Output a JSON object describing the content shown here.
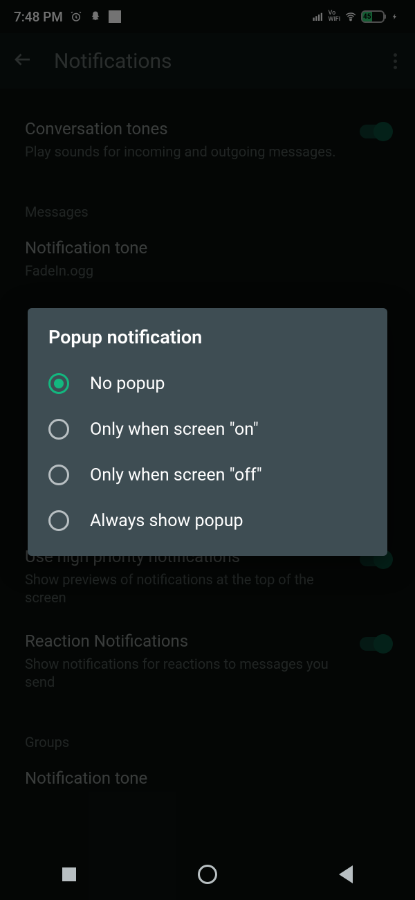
{
  "status": {
    "time": "7:48 PM",
    "battery_pct": "45"
  },
  "appbar": {
    "title": "Notifications"
  },
  "settings": {
    "conv_tones": {
      "title": "Conversation tones",
      "sub": "Play sounds for incoming and outgoing messages."
    },
    "section_messages": "Messages",
    "notif_tone": {
      "title": "Notification tone",
      "sub": "FadeIn.ogg"
    },
    "high_priority": {
      "title": "Use high priority notifications",
      "sub": "Show previews of notifications at the top of the screen"
    },
    "reaction": {
      "title": "Reaction Notifications",
      "sub": "Show notifications for reactions to messages you send"
    },
    "section_groups": "Groups",
    "group_tone": {
      "title": "Notification tone"
    }
  },
  "dialog": {
    "title": "Popup notification",
    "options": {
      "0": "No popup",
      "1": "Only when screen \"on\"",
      "2": "Only when screen \"off\"",
      "3": "Always show popup"
    },
    "selected_index": 0
  }
}
